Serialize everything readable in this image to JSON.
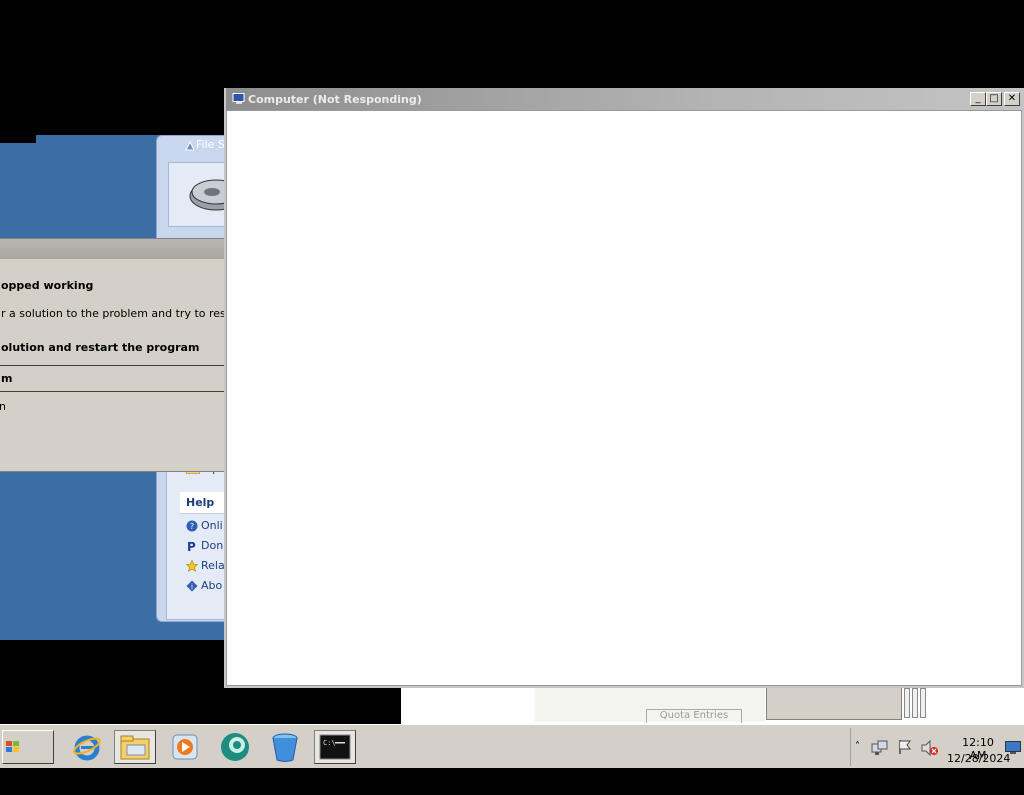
{
  "main_window": {
    "title": "Computer (Not Responding)",
    "minimize_glyph": "_",
    "maximize_glyph": "□",
    "close_glyph": "✕"
  },
  "file_panel": {
    "title": "File S",
    "help_header": "Help",
    "help_items": [
      "Onli",
      "Don",
      "Rela",
      "Abo"
    ],
    "partial_item": "Op"
  },
  "error_dialog": {
    "heading": "opped working",
    "description": "r a solution to the problem and try to restart the program.",
    "option_check_online": "olution and restart the program",
    "option_close": "m",
    "option_debug": "n",
    "close_glyph": "✕"
  },
  "behind": {
    "quota_button": "Quota Entries"
  },
  "taskbar": {
    "start_label": "Start",
    "icons": [
      "internet-explorer-icon",
      "file-explorer-icon",
      "media-player-icon",
      "app-icon",
      "recycle-bucket-icon",
      "command-prompt-icon"
    ],
    "tray": {
      "time": "12:10 AM",
      "date": "12/28/2024"
    }
  }
}
